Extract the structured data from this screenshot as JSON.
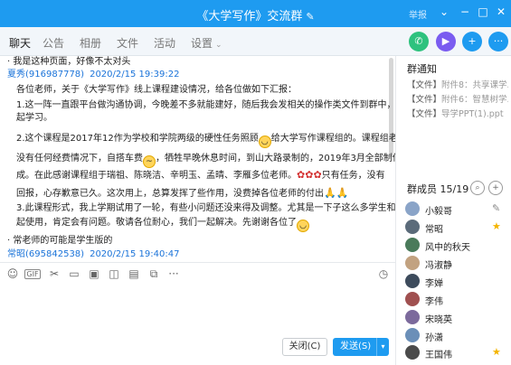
{
  "window": {
    "title": "《大学写作》交流群",
    "report_label": "举报"
  },
  "tabs": [
    {
      "label": "聊天"
    },
    {
      "label": "公告"
    },
    {
      "label": "相册"
    },
    {
      "label": "文件"
    },
    {
      "label": "活动"
    },
    {
      "label": "设置"
    }
  ],
  "chat": {
    "lines": [
      {
        "kind": "text",
        "text": "· 我是这种页面，好像不太对头"
      },
      {
        "kind": "sender",
        "name": "夏秀",
        "qq": "(916987778)",
        "time": "2020/2/15 19:39:22"
      },
      {
        "kind": "text",
        "text": "各位老师，关于《大学写作》线上课程建设情况，给各位做如下汇报："
      },
      {
        "kind": "text",
        "text": "1.这一阵一直跟平台做沟通协调，今晚差不多就能建好，随后我会发相关的操作类文件到群中，大家一"
      },
      {
        "kind": "text",
        "text": "起学习。"
      },
      {
        "kind": "text",
        "text": "2.这个课程是2017年12作为学校和学院两级的硬性任务照顾",
        "tail": "给大学写作课程组的。课程组老师在"
      },
      {
        "kind": "text",
        "text": "没有任何经费情况下，自搭车费",
        "tail": "，牺牲早晚休息时间，到山大路录制的，2019年3月全部制作完"
      },
      {
        "kind": "text",
        "text": "成。在此感谢课程组于瑞祖、陈晓洁、辛明玉、孟晴、李雁多位老师。",
        "tail": "只有任务，没有"
      },
      {
        "kind": "text",
        "text": "回报，心存歉意已久。这次用上，总算发挥了些作用，没费掉各位老师的付出"
      },
      {
        "kind": "text",
        "text": "3.此课程形式，我上学期试用了一轮，有些小问题还没来得及调整。尤其是一下子这么多学生和老师一"
      },
      {
        "kind": "text",
        "text": "起使用，肯定会有问题。敬请各位耐心，我们一起解决。先谢谢各位了"
      },
      {
        "kind": "text",
        "text": "· 常老师的可能是学生版的"
      },
      {
        "kind": "sender",
        "name": "常昭",
        "qq": "(695842538)",
        "time": "2020/2/15 19:40:47"
      }
    ]
  },
  "input": {
    "close_label": "关闭(C)",
    "send_label": "发送(S)"
  },
  "notice": {
    "title": "群通知",
    "files": [
      {
        "prefix": "【文件】",
        "name": "附件8：共享课学..."
      },
      {
        "prefix": "【文件】",
        "name": "附件6：智慧树学..."
      },
      {
        "prefix": "【文件】",
        "name": "导学PPT(1).ppt"
      }
    ]
  },
  "members": {
    "header": "群成员 15/19",
    "list": [
      {
        "name": "小毅哥",
        "badge": "edit-icon"
      },
      {
        "name": "常昭",
        "badge": "star-icon"
      },
      {
        "name": "风中的秋天"
      },
      {
        "name": "冯淑静"
      },
      {
        "name": "李婵"
      },
      {
        "name": "李伟"
      },
      {
        "name": "宋晓英"
      },
      {
        "name": "孙潇"
      },
      {
        "name": "王国伟",
        "badge": "star-icon"
      }
    ]
  },
  "colors": {
    "accent": "#1e9bf0",
    "link": "#1a73d9",
    "phone": "#2ec27e",
    "video": "#7a5cf0",
    "share": "#1e9bf0",
    "star": "#f4b400"
  }
}
